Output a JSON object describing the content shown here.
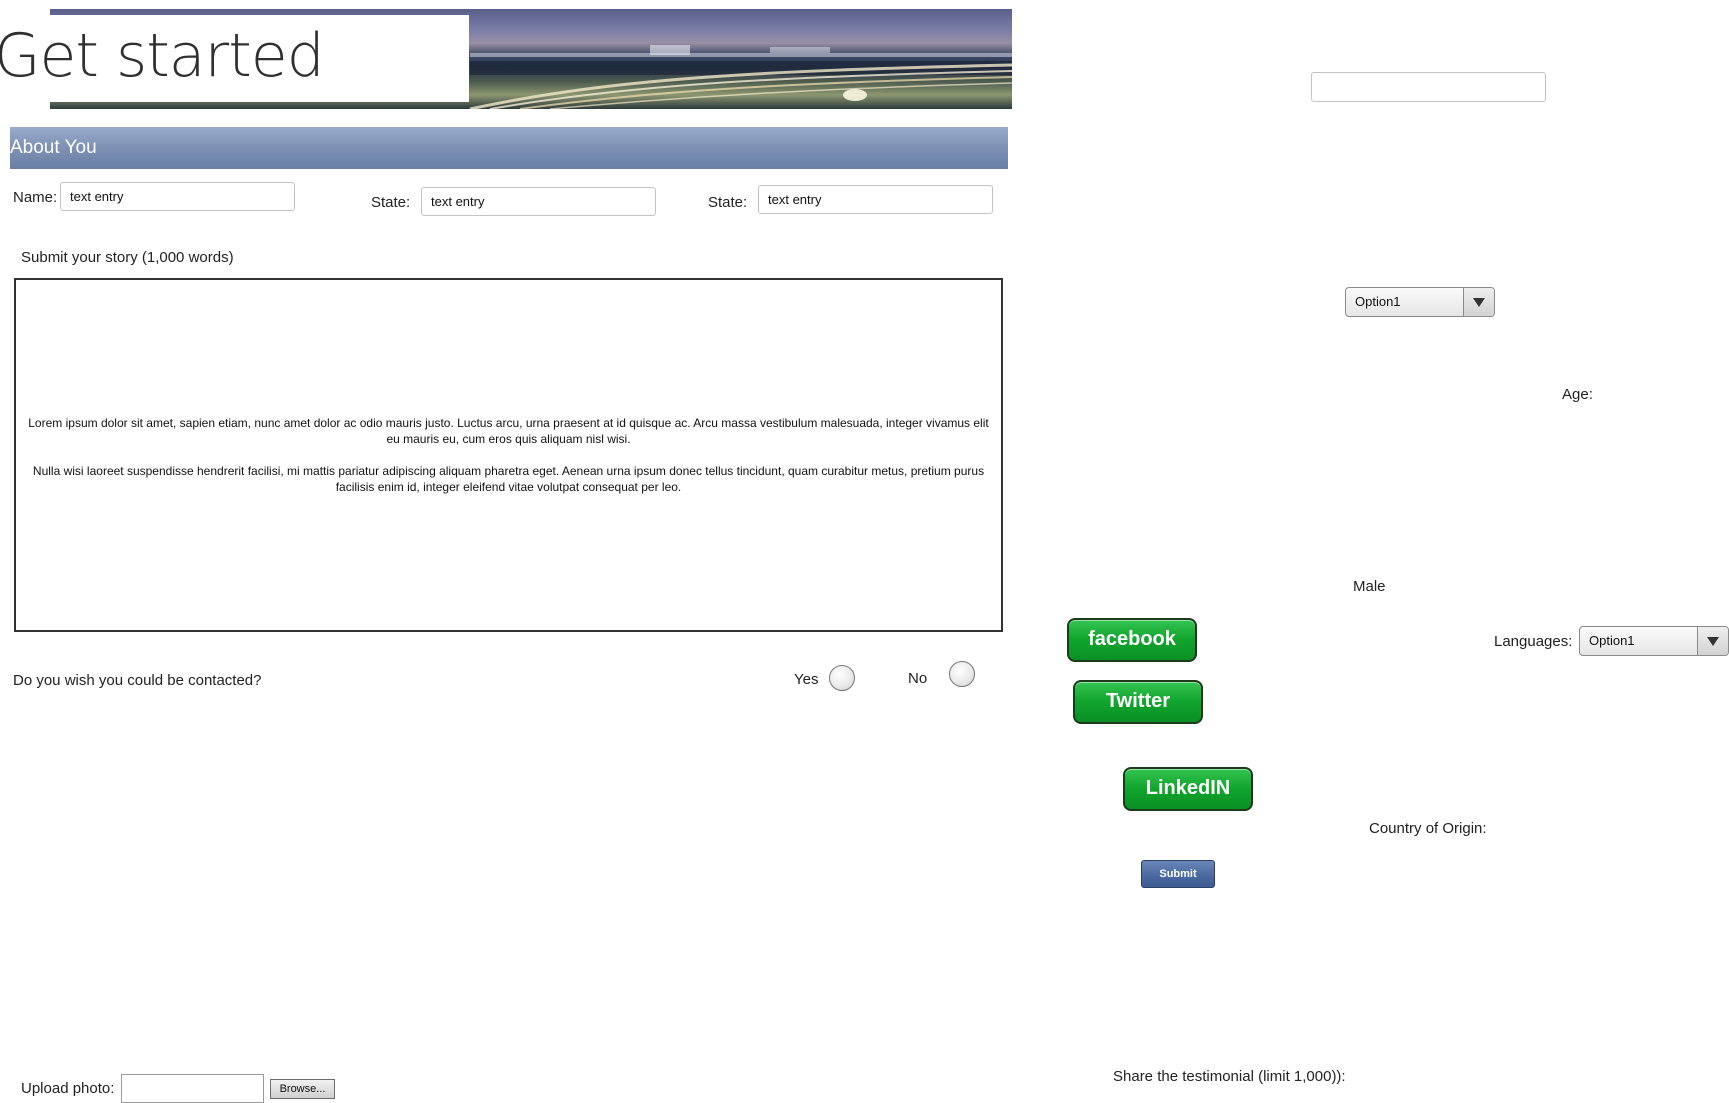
{
  "header": {
    "title": "Get started"
  },
  "section": {
    "title": "About You"
  },
  "fields": {
    "name_label": "Name:",
    "name_value": "text entry",
    "state1_label": "State:",
    "state1_value": "text entry",
    "state2_label": "State:",
    "state2_value": "text entry",
    "top_right_input_value": ""
  },
  "story": {
    "label": "Submit your story (1,000 words)",
    "paragraph1": "Lorem ipsum dolor sit amet, sapien etiam, nunc amet dolor ac odio mauris justo. Luctus arcu, urna praesent at id quisque ac. Arcu massa vestibulum malesuada, integer vivamus elit eu mauris eu, cum eros quis aliquam nisl wisi.",
    "paragraph2": "Nulla wisi laoreet suspendisse hendrerit facilisi, mi mattis pariatur adipiscing aliquam pharetra eget. Aenean urna ipsum donec tellus tincidunt, quam curabitur metus, pretium purus facilisis enim id, integer eleifend vitae volutpat consequat per leo."
  },
  "contact": {
    "question": "Do you wish you could be contacted?",
    "yes_label": "Yes",
    "no_label": "No"
  },
  "right_panel": {
    "select1_value": "Option1",
    "age_label": "Age:",
    "gender_label": "Male",
    "languages_label": "Languages:",
    "languages_value": "Option1",
    "country_label": "Country of Origin:",
    "testimonial_label": "Share the testimonial (limit 1,000)):"
  },
  "social": {
    "facebook": "facebook",
    "twitter": "Twitter",
    "linkedin": "LinkedIN"
  },
  "actions": {
    "submit_label": "Submit",
    "browse_label": "Browse..."
  },
  "upload": {
    "label": "Upload photo:",
    "value": ""
  },
  "colors": {
    "section_bar": "#7f93b6",
    "social_green": "#11a52e",
    "submit_blue": "#4b6aa1"
  }
}
